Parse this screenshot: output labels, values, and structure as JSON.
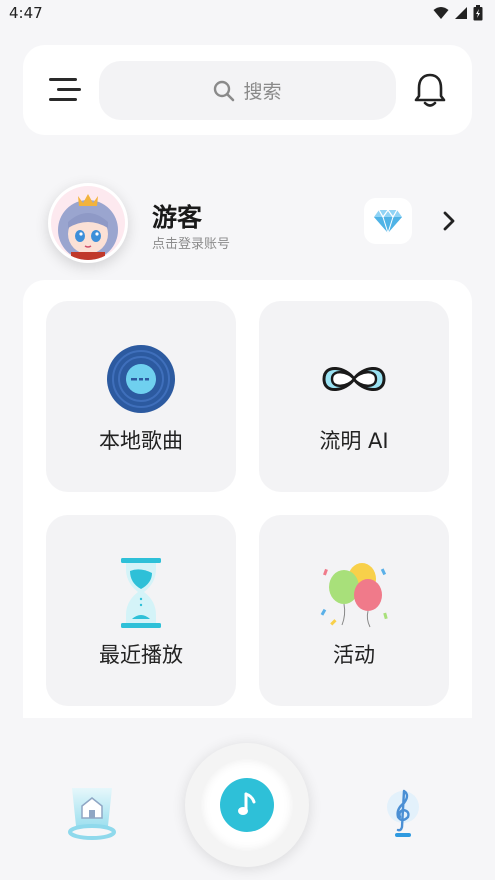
{
  "status_bar": {
    "time": "4:47",
    "icons": [
      "wifi-icon",
      "cell-signal-icon",
      "battery-charging-icon"
    ]
  },
  "header": {
    "search_placeholder": "搜索",
    "icons": [
      "menu-icon",
      "search-icon",
      "bell-icon"
    ]
  },
  "profile": {
    "name": "游客",
    "subtitle": "点击登录账号",
    "icons": [
      "avatar-image",
      "diamond-icon",
      "chevron-right-icon"
    ]
  },
  "tiles": [
    {
      "label": "本地歌曲",
      "icon": "vinyl-record-icon",
      "color": "#2c5aa0"
    },
    {
      "label": "流明 AI",
      "icon": "infinity-icon",
      "color": "#5bc8e8"
    },
    {
      "label": "最近播放",
      "icon": "hourglass-icon",
      "color": "#2ec0d8"
    },
    {
      "label": "活动",
      "icon": "balloons-icon",
      "color": "#f07a8a"
    }
  ],
  "bottom_nav": {
    "items": [
      "home-icon",
      "music-note-icon",
      "treble-clef-icon"
    ],
    "accent": "#2ec0d8"
  }
}
